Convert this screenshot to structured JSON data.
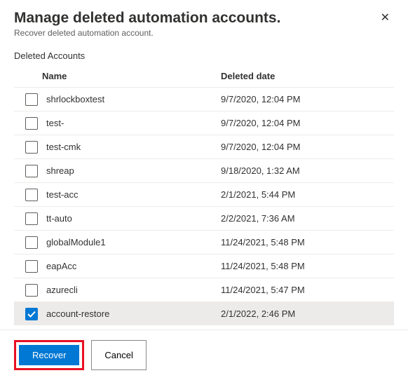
{
  "header": {
    "title": "Manage deleted automation accounts.",
    "subtitle": "Recover deleted automation account."
  },
  "section_label": "Deleted Accounts",
  "columns": {
    "name": "Name",
    "date": "Deleted date"
  },
  "rows": [
    {
      "name": "shrlockboxtest",
      "date": "9/7/2020, 12:04 PM",
      "checked": false
    },
    {
      "name": "test-",
      "date": "9/7/2020, 12:04 PM",
      "checked": false
    },
    {
      "name": "test-cmk",
      "date": "9/7/2020, 12:04 PM",
      "checked": false
    },
    {
      "name": "shreap",
      "date": "9/18/2020, 1:32 AM",
      "checked": false
    },
    {
      "name": "test-acc",
      "date": "2/1/2021, 5:44 PM",
      "checked": false
    },
    {
      "name": "tt-auto",
      "date": "2/2/2021, 7:36 AM",
      "checked": false
    },
    {
      "name": "globalModule1",
      "date": "11/24/2021, 5:48 PM",
      "checked": false
    },
    {
      "name": "eapAcc",
      "date": "11/24/2021, 5:48 PM",
      "checked": false
    },
    {
      "name": "azurecli",
      "date": "11/24/2021, 5:47 PM",
      "checked": false
    },
    {
      "name": "account-restore",
      "date": "2/1/2022, 2:46 PM",
      "checked": true
    }
  ],
  "footer": {
    "recover": "Recover",
    "cancel": "Cancel"
  }
}
